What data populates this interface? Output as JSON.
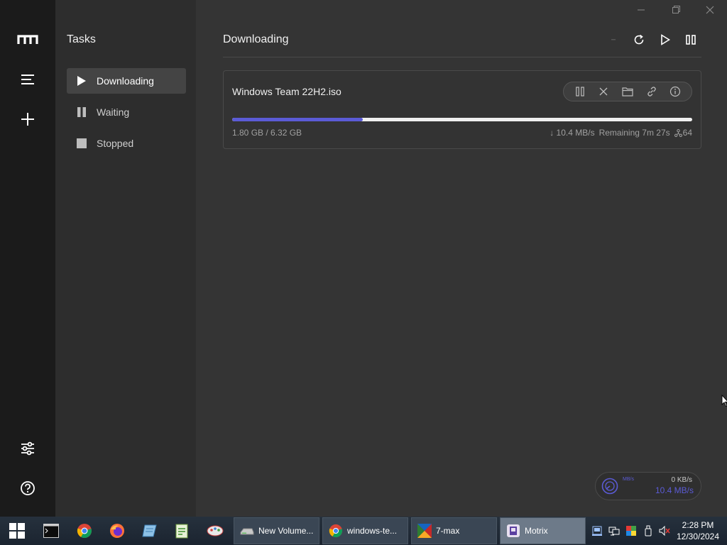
{
  "sidebar": {
    "title": "Tasks",
    "items": [
      {
        "label": "Downloading",
        "active": true
      },
      {
        "label": "Waiting",
        "active": false
      },
      {
        "label": "Stopped",
        "active": false
      }
    ]
  },
  "main": {
    "heading": "Downloading"
  },
  "task": {
    "name": "Windows Team 22H2.iso",
    "progress": 0.284,
    "size": "1.80 GB / 6.32 GB",
    "speed": "↓ 10.4 MB/s",
    "remaining": "Remaining 7m 27s",
    "connections": "64"
  },
  "speedmeter": {
    "unit_label": "MB/s",
    "upload": "0 KB/s",
    "download": "10.4 MB/s"
  },
  "taskbar": {
    "buttons": [
      {
        "label": "New Volume..."
      },
      {
        "label": "windows-te..."
      },
      {
        "label": "7-max"
      },
      {
        "label": "Motrix"
      }
    ],
    "time": "2:28 PM",
    "date": "12/30/2024"
  },
  "colors": {
    "accent": "#5b5bd6",
    "rail": "#1b1b1b",
    "subnav": "#2d2d2d",
    "main": "#343434"
  }
}
